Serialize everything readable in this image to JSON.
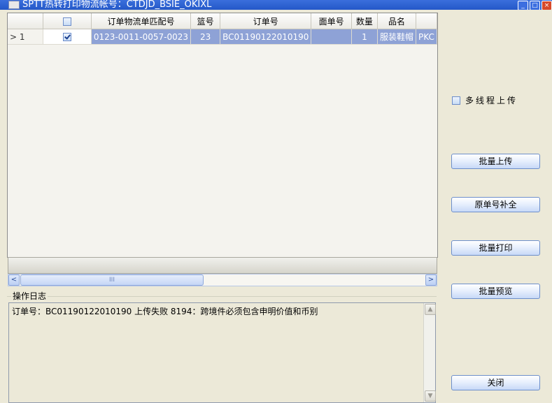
{
  "window": {
    "title": "SPTT热转打印物流帐号：CTDJD_BSIE_OKIXL",
    "buttons": [
      "_",
      "□",
      "×"
    ]
  },
  "grid": {
    "columns": [
      "",
      "",
      "订单物流单匹配号",
      "篮号",
      "订单号",
      "面单号",
      "数量",
      "品名",
      ""
    ],
    "rows": [
      {
        "row_marker": "> 1",
        "checked": true,
        "match_no": "0123-0011-0057-0023",
        "basket_no": "23",
        "order_no": "BC01190122010190",
        "waybill_no": "",
        "quantity": "1",
        "product_name": "服装鞋帽",
        "extra": "PKC"
      }
    ],
    "header_checkbox_checked": false
  },
  "scrollbar": {
    "left_arrow": "<",
    "right_arrow": ">",
    "thumb_grip": "III"
  },
  "log": {
    "title": "操作日志",
    "text": "订单号：BC01190122010190 上传失败 8194：跨境件必须包含申明价值和币别"
  },
  "options": {
    "multithread_label": "多线程上传",
    "multithread_checked": false
  },
  "actions": {
    "batch_upload": "批量上传",
    "complete_original_no": "原单号补全",
    "batch_print": "批量打印",
    "batch_preview": "批量预览",
    "close": "关闭"
  }
}
